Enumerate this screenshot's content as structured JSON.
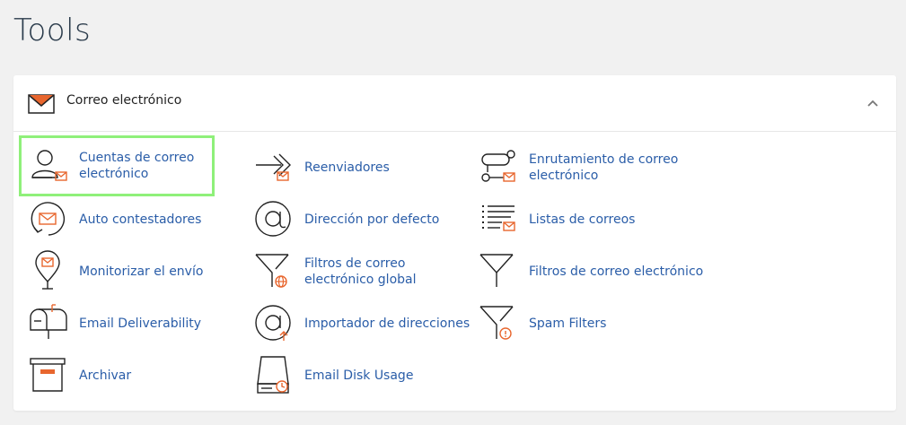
{
  "page": {
    "title": "Tools"
  },
  "panel": {
    "title": "Correo electrónico",
    "colors": {
      "accent": "#e8662e",
      "link": "#2a5da8",
      "highlight": "#8ff07a"
    }
  },
  "items": [
    {
      "label": "Cuentas de correo electrónico",
      "icon": "user-mail-icon"
    },
    {
      "label": "Reenviadores",
      "icon": "forward-mail-icon"
    },
    {
      "label": "Enrutamiento de correo electrónico",
      "icon": "routing-mail-icon"
    },
    {
      "label": "Auto contestadores",
      "icon": "autoreply-icon"
    },
    {
      "label": "Dirección por defecto",
      "icon": "at-sign-icon"
    },
    {
      "label": "Listas de correos",
      "icon": "mailing-list-icon"
    },
    {
      "label": "Monitorizar el envío",
      "icon": "location-pin-mail-icon"
    },
    {
      "label": "Filtros de correo electrónico global",
      "icon": "filter-globe-icon"
    },
    {
      "label": "Filtros de correo electrónico",
      "icon": "filter-icon"
    },
    {
      "label": "Email Deliverability",
      "icon": "mailbox-icon"
    },
    {
      "label": "Importador de direcciones",
      "icon": "at-import-icon"
    },
    {
      "label": "Spam Filters",
      "icon": "filter-alert-icon"
    },
    {
      "label": "Archivar",
      "icon": "archive-box-icon"
    },
    {
      "label": "Email Disk Usage",
      "icon": "disk-usage-icon"
    }
  ]
}
